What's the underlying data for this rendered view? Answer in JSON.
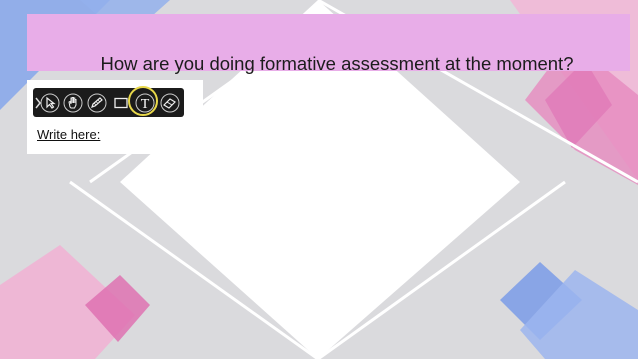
{
  "slide": {
    "title": "How are you doing formative assessment at the moment?",
    "prompt": "Write here:",
    "background_color": "#dadadd",
    "title_bar_color": "#e8ade8",
    "accent_pink": "#e07bb8",
    "accent_blue": "#7b9ee6"
  },
  "toolbar": {
    "tools": [
      {
        "icon": "chevron-icon",
        "selected": false
      },
      {
        "icon": "pointer-arrow-icon",
        "selected": false
      },
      {
        "icon": "hand-icon",
        "selected": false
      },
      {
        "icon": "pen-icon",
        "selected": false
      },
      {
        "icon": "rectangle-icon",
        "selected": false
      },
      {
        "icon": "text-icon",
        "label": "T",
        "selected": true
      },
      {
        "icon": "eraser-icon",
        "selected": false
      }
    ],
    "highlight_color": "#e8d84a"
  }
}
